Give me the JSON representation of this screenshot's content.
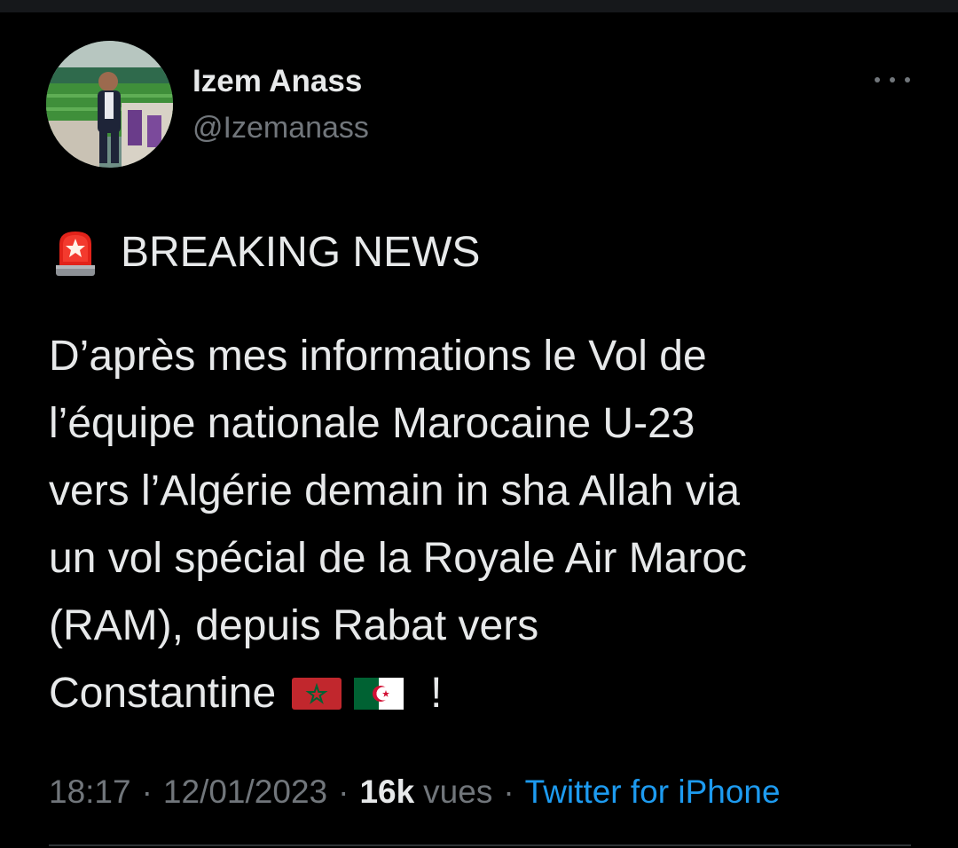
{
  "author": {
    "name": "Izem Anass",
    "handle": "@Izemanass"
  },
  "tweet": {
    "headline": "BREAKING NEWS",
    "lines": [
      "D’après mes informations le Vol de",
      "l’équipe nationale Marocaine U-23",
      "vers l’Algérie demain in sha Allah via",
      "un vol spécial de la Royale Air Maroc",
      "(RAM), depuis Rabat vers",
      "Constantine"
    ],
    "closing": "!"
  },
  "meta": {
    "time": "18:17",
    "separator": "·",
    "date": "12/01/2023",
    "views_count": "16k",
    "views_label": "vues",
    "source": "Twitter for iPhone"
  },
  "colors": {
    "background": "#000000",
    "text": "#e7e9ea",
    "secondary": "#71767b",
    "link": "#1d9bf0"
  },
  "icons": {
    "headline_icon": "police-siren-emoji",
    "flags": [
      "morocco-flag",
      "algeria-flag"
    ],
    "more": "more-options-icon"
  }
}
